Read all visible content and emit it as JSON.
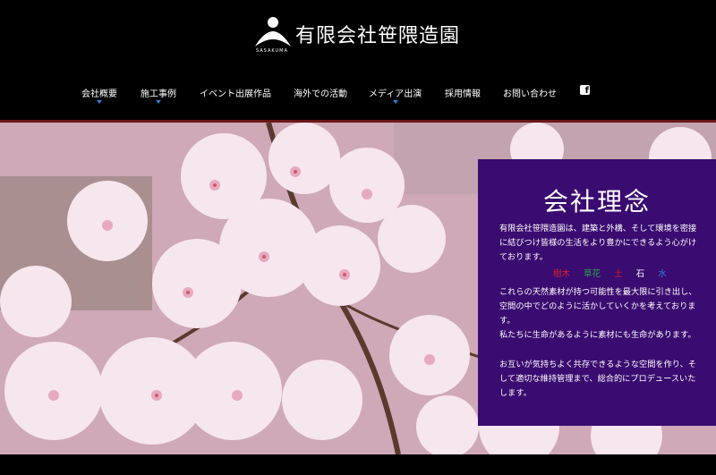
{
  "header": {
    "company_name": "有限会社笹隈造園",
    "logo_text": "SASAKUMA"
  },
  "nav": {
    "items": [
      {
        "label": "会社概要",
        "has_dropdown": true
      },
      {
        "label": "施工事例",
        "has_dropdown": true
      },
      {
        "label": "イベント出展作品",
        "has_dropdown": false
      },
      {
        "label": "海外での活動",
        "has_dropdown": false
      },
      {
        "label": "メディア出演",
        "has_dropdown": true
      },
      {
        "label": "採用情報",
        "has_dropdown": false
      },
      {
        "label": "お問い合わせ",
        "has_dropdown": false
      }
    ],
    "social_icon": "facebook-icon"
  },
  "philosophy": {
    "title": "会社理念",
    "para1": "有限会社笹隈造園は、建築と外構、そして環境を密接に結びつけ皆様の生活をより豊かにできるよう心がけております。",
    "elements": [
      {
        "label": "樹木",
        "color": "#e0202e"
      },
      {
        "label": "草花",
        "color": "#2aa84a"
      },
      {
        "label": "土",
        "color": "#e0202e"
      },
      {
        "label": "石",
        "color": "#ffffff"
      },
      {
        "label": "水",
        "color": "#2f7fe0"
      }
    ],
    "para2": "これらの天然素材が持つ可能性を最大限に引き出し、空間の中でどのように活かしていくかを考えております。",
    "para3": "私たちに生命があるように素材にも生命があります。",
    "para4": "お互いが気持ちよく共存できるような空間を作り、そして適切な維持管理まで、総合的にプロデュースいたします。"
  },
  "colors": {
    "panel_bg": "#3a0b70",
    "stripe": "#6b1717",
    "caret": "#2f7fd0"
  }
}
